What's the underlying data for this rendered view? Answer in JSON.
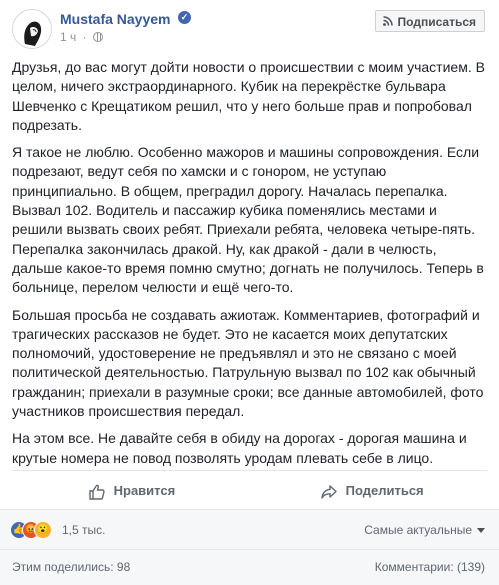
{
  "author": {
    "name": "Mustafa Nayyem",
    "verified_glyph": "✓"
  },
  "meta": {
    "time": "1 ч",
    "dot": "·",
    "privacy_icon": "globe-icon"
  },
  "subscribe_label": "Подписаться",
  "post": {
    "paragraphs": [
      "Друзья, до вас могут дойти новости о происшествии с моим участием. В целом, ничего экстраординарного. Кубик на перекрёстке бульвара Шевченко с Крещатиком решил, что у него больше прав и попробовал подрезать.",
      "Я такое не люблю. Особенно мажоров и машины сопровождения. Если подрезают, ведут себя по хамски и с гонором, не уступаю принципиально. В общем, преградил дорогу. Началась перепалка. Вызвал 102. Водитель и пассажир кубика поменялись местами и решили вызвать своих ребят. Приехали ребята, человека четыре-пять. Перепалка закончилась дракой. Ну, как дракой - дали в челюсть, дальше какое-то время помню смутно; догнать не получилось. Теперь в больнице, перелом челюсти и ещё чего-то.",
      "Большая просьба не создавать ажиотаж. Комментариев, фотографий и трагических рассказов не будет. Это не касается моих депутатских полномочий, удостоверение не предъявлял и это не связано с моей политической деятельностью. Патрульную вызвал по 102 как обычный гражданин; приехали в разумные сроки; все данные автомобилей, фото участников происшествия передал.",
      "На этом все. Не давайте себя в обиду на дорогах - дорогая машина и крутые номера не повод позволять уродам плевать себе в лицо."
    ]
  },
  "actions": {
    "like": "Нравится",
    "share": "Поделиться"
  },
  "reactions": {
    "count": "1,5 тыс.",
    "sort_label": "Самые актуальные",
    "like_glyph": "👍",
    "angry_glyph": "😡",
    "wow_glyph": "😮"
  },
  "footer": {
    "shares": "Этим поделились: 98",
    "comments": "Комментарии: (139)"
  },
  "colors": {
    "link": "#365899",
    "accent": "#4267b2",
    "muted": "#90949c"
  }
}
